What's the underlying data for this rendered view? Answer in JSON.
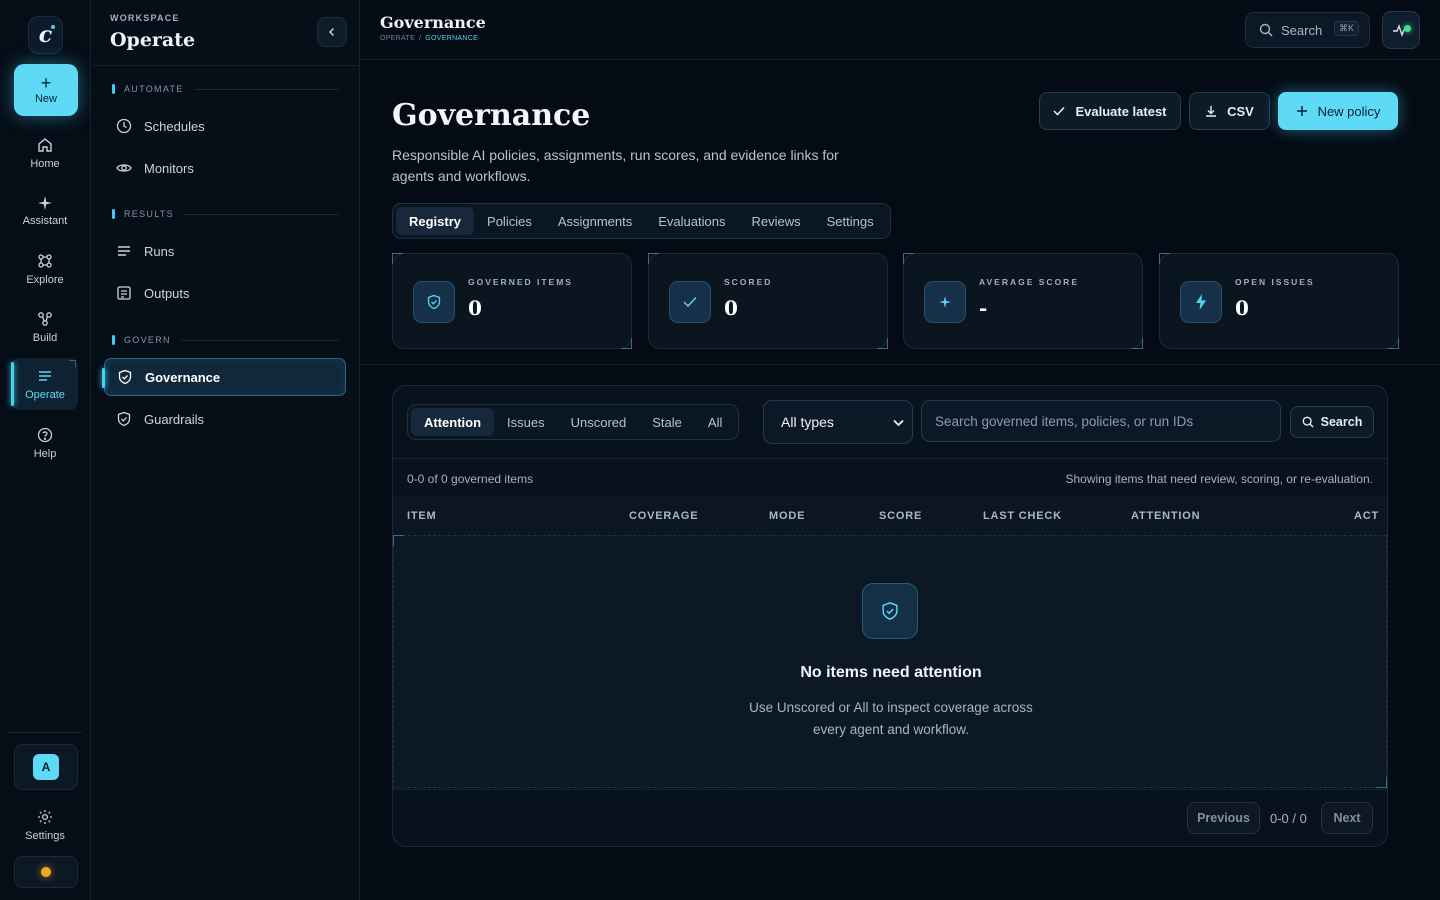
{
  "rail": {
    "logo_letter": "c",
    "new_label": "New",
    "items": [
      {
        "label": "Home",
        "icon": "home-icon"
      },
      {
        "label": "Assistant",
        "icon": "sparkle-icon"
      },
      {
        "label": "Explore",
        "icon": "explore-icon"
      },
      {
        "label": "Build",
        "icon": "build-icon"
      },
      {
        "label": "Operate",
        "icon": "operate-icon",
        "active": true
      },
      {
        "label": "Help",
        "icon": "help-icon"
      }
    ],
    "avatar_letter": "A",
    "settings_label": "Settings",
    "status_color": "#f5a524"
  },
  "panel": {
    "workspace_label": "WORKSPACE",
    "workspace_name": "Operate",
    "sections": [
      {
        "label": "AUTOMATE",
        "items": [
          {
            "label": "Schedules",
            "icon": "clock-icon"
          },
          {
            "label": "Monitors",
            "icon": "eye-icon"
          }
        ]
      },
      {
        "label": "RESULTS",
        "items": [
          {
            "label": "Runs",
            "icon": "list-icon"
          },
          {
            "label": "Outputs",
            "icon": "document-icon"
          }
        ]
      },
      {
        "label": "GOVERN",
        "items": [
          {
            "label": "Governance",
            "icon": "shield-check-icon",
            "active": true
          },
          {
            "label": "Guardrails",
            "icon": "shield-check-icon"
          }
        ]
      }
    ]
  },
  "topbar": {
    "title": "Governance",
    "breadcrumb": [
      "OPERATE",
      "GOVERNANCE"
    ],
    "search_label": "Search",
    "search_shortcut": "⌘K"
  },
  "page": {
    "title": "Governance",
    "description": "Responsible AI policies, assignments, run scores, and evidence links for agents and workflows.",
    "actions": {
      "evaluate": "Evaluate latest",
      "csv": "CSV",
      "new_policy": "New policy"
    },
    "tabs": [
      "Registry",
      "Policies",
      "Assignments",
      "Evaluations",
      "Reviews",
      "Settings"
    ],
    "active_tab": "Registry",
    "stats": [
      {
        "label": "GOVERNED ITEMS",
        "value": "0",
        "icon": "shield-check-icon"
      },
      {
        "label": "SCORED",
        "value": "0",
        "icon": "check-icon"
      },
      {
        "label": "AVERAGE SCORE",
        "value": "-",
        "icon": "sparkle-icon"
      },
      {
        "label": "OPEN ISSUES",
        "value": "0",
        "icon": "bolt-icon"
      }
    ]
  },
  "registry": {
    "filters": [
      "Attention",
      "Issues",
      "Unscored",
      "Stale",
      "All"
    ],
    "active_filter": "Attention",
    "type_select": "All types",
    "search_placeholder": "Search governed items, policies, or run IDs",
    "search_button": "Search",
    "count_text": "0-0 of 0 governed items",
    "hint_text": "Showing items that need review, scoring, or re-evaluation.",
    "columns": [
      "ITEM",
      "COVERAGE",
      "MODE",
      "SCORE",
      "LAST CHECK",
      "ATTENTION",
      "ACT"
    ],
    "empty": {
      "title": "No items need attention",
      "subtitle": "Use Unscored or All to inspect coverage across every agent and workflow."
    },
    "pager": {
      "previous": "Previous",
      "info": "0-0 / 0",
      "next": "Next"
    }
  },
  "colors": {
    "accent": "#5fdaf6",
    "background": "#040b14",
    "live": "#3ee08f"
  }
}
